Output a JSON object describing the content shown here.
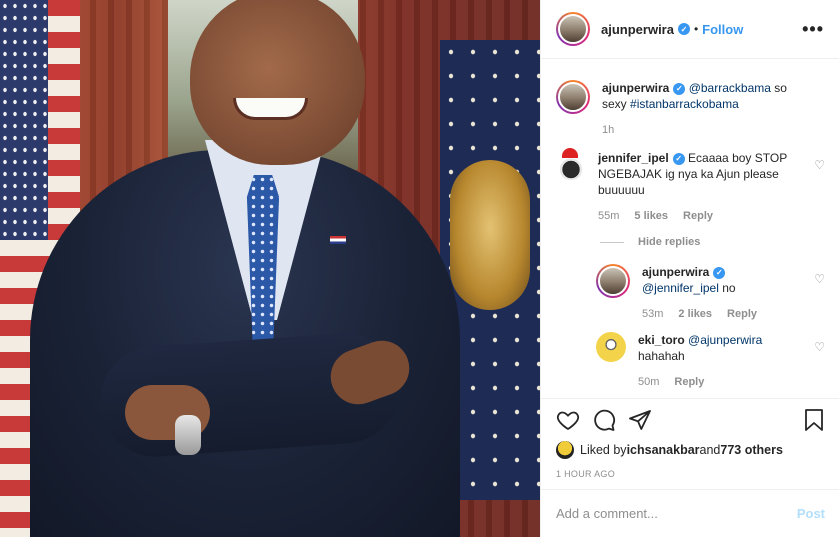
{
  "post": {
    "author": "ajunperwira",
    "follow_label": "Follow",
    "more_label": "•••",
    "dot": "•"
  },
  "comments": [
    {
      "user": "ajunperwira",
      "verified": true,
      "mention": "@barrackbama",
      "text": " so sexy ",
      "hashtag": "#istanbarrackobama",
      "time": "1h"
    },
    {
      "user": "jennifer_ipel",
      "verified": true,
      "text": "Ecaaaa boy STOP NGEBAJAK ig nya ka Ajun please buuuuuu",
      "time": "55m",
      "likes": "5 likes",
      "reply_label": "Reply",
      "hide_replies": "Hide replies",
      "replies": [
        {
          "user": "ajunperwira",
          "verified": true,
          "mention": "@jennifer_ipel",
          "text": " no",
          "time": "53m",
          "likes": "2 likes",
          "reply_label": "Reply"
        },
        {
          "user": "eki_toro",
          "mention": "@ajunperwira",
          "text": "hahahah",
          "time": "50m",
          "reply_label": "Reply"
        }
      ]
    }
  ],
  "likes": {
    "prefix": "Liked by ",
    "user": "ichsanakbar",
    "middle": " and ",
    "others": "773 others"
  },
  "timestamp": "1 HOUR AGO",
  "composer": {
    "placeholder": "Add a comment...",
    "post_label": "Post"
  },
  "icons": {
    "like": "heart-icon",
    "comment": "comment-icon",
    "share": "share-icon",
    "save": "bookmark-icon",
    "verified_glyph": "✓"
  },
  "colors": {
    "link": "#003569",
    "brand_blue": "#3897f0",
    "post_disabled": "#b2dffc",
    "muted": "#8e8e8e"
  }
}
